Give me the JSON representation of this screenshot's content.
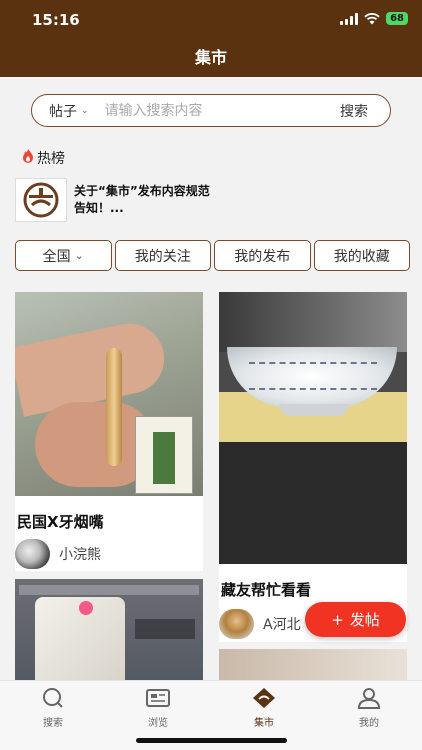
{
  "status_bar": {
    "time": "15:16",
    "battery": "68"
  },
  "header": {
    "title": "集市"
  },
  "search": {
    "type_label": "帖子",
    "placeholder": "请输入搜索内容",
    "button_label": "搜索"
  },
  "hot": {
    "title": "热榜",
    "item_text": "关于“集市”发布内容规范告知！..."
  },
  "filters": [
    {
      "label": "全国"
    },
    {
      "label": "我的关注"
    },
    {
      "label": "我的发布"
    },
    {
      "label": "我的收藏"
    }
  ],
  "posts": [
    {
      "title": "民国Ⅹ牙烟嘴",
      "author": "小浣熊"
    },
    {
      "title": "藏友帮忙看看",
      "author": "A河北"
    }
  ],
  "fab": {
    "label": "发帖"
  },
  "tabbar": [
    {
      "label": "搜索"
    },
    {
      "label": "浏览"
    },
    {
      "label": "集市"
    },
    {
      "label": "我的"
    }
  ],
  "colors": {
    "brand": "#5a3210",
    "accent": "#f03322"
  }
}
